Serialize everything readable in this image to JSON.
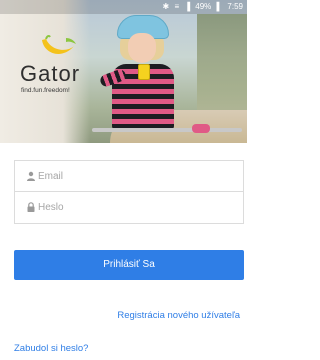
{
  "status_bar": {
    "icons": [
      "bluetooth-icon",
      "wifi-icon",
      "signal-icon",
      "battery-icon"
    ],
    "battery": "49%",
    "time": "7:59"
  },
  "brand": {
    "name": "Gator",
    "tagline": "find.fun.freedom!",
    "logo_icon": "banana-logo-icon",
    "logo_colors": [
      "#f4c21b",
      "#8cc63f"
    ]
  },
  "login_form": {
    "email_placeholder": "Email",
    "email_value": "",
    "email_icon": "person-icon",
    "password_placeholder": "Heslo",
    "password_value": "",
    "password_icon": "lock-icon",
    "submit_label": "Prihlásiť Sa"
  },
  "links": {
    "register": "Registrácia nového užívateľa",
    "forgot_password": "Zabudol si heslo?"
  },
  "colors": {
    "accent": "#2f7ee6",
    "field_border": "#dcdcdc",
    "placeholder": "#a6a6a6"
  }
}
